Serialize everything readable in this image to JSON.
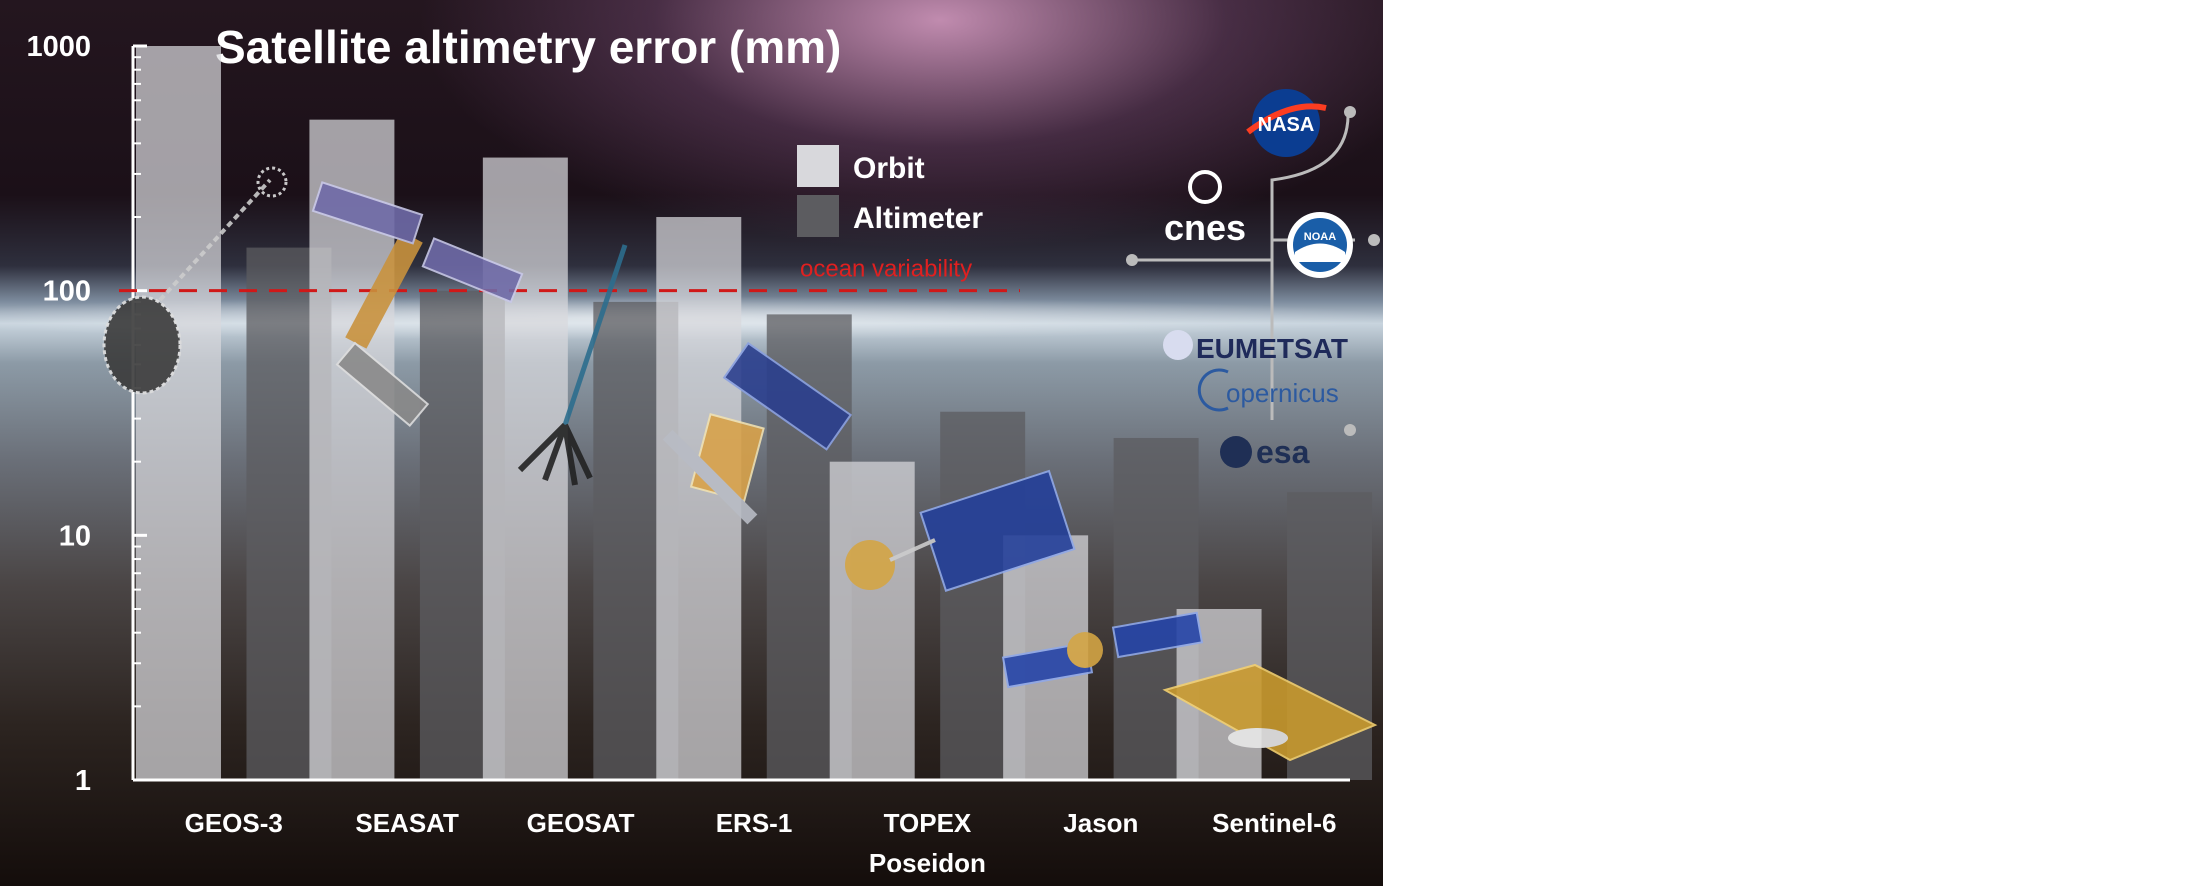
{
  "chart_data": {
    "type": "bar",
    "title": "Satellite altimetry error (mm)",
    "y_scale": "log",
    "ylim": [
      1,
      1000
    ],
    "y_ticks": [
      1,
      10,
      100,
      1000
    ],
    "categories": [
      "GEOS-3",
      "SEASAT",
      "GEOSAT",
      "ERS-1",
      "TOPEX Poseidon",
      "Jason",
      "Sentinel-6"
    ],
    "series": [
      {
        "name": "Orbit",
        "values": [
          1000,
          500,
          350,
          200,
          20,
          10,
          5
        ]
      },
      {
        "name": "Altimeter",
        "values": [
          150,
          100,
          90,
          80,
          32,
          25,
          15
        ]
      }
    ],
    "reference_line": {
      "value": 100,
      "label": "ocean variability"
    },
    "legend": "top-center",
    "grid": false
  },
  "colors": {
    "orbit_bar": "#d8d8dc",
    "altimeter_bar": "#5c5c60",
    "reference_line": "#d01818",
    "highlight_tick": "#e81818",
    "text": "#ffffff"
  },
  "logos": {
    "nasa": "NASA",
    "cnes": "cnes",
    "noaa": "NOAA",
    "eumetsat": "EUMETSAT",
    "copernicus": "opernicus",
    "esa": "esa"
  }
}
